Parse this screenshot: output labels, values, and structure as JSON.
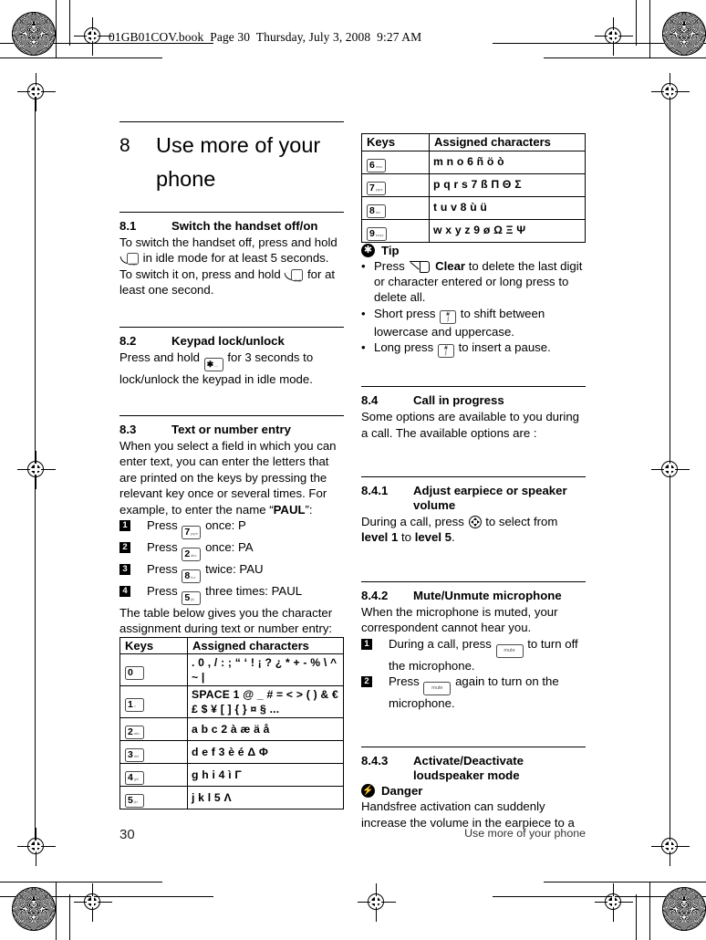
{
  "page_header": "01GB01COV.book  Page 30  Thursday, July 3, 2008  9:27 AM",
  "chapter": {
    "number": "8",
    "title_line1": "Use more of your",
    "title_line2": "phone"
  },
  "sections": {
    "s81": {
      "num": "8.1",
      "title": "Switch the handset off/on",
      "p1a": "To switch the handset off, press and hold",
      "p1b": "in idle mode for at least 5 seconds. To switch it on, press and hold",
      "p1c": "for at least one second."
    },
    "s82": {
      "num": "8.2",
      "title": "Keypad lock/unlock",
      "p1a": "Press and hold",
      "p1b": "for 3 seconds to lock/unlock the keypad in idle mode."
    },
    "s83": {
      "num": "8.3",
      "title": "Text or number entry",
      "p1": "When you select a field in which you can enter text, you can enter the letters that are printed on the keys by pressing the relevant key once or several times. For example, to enter the name “",
      "p1_bold": "PAUL",
      "p1_end": "”:",
      "steps": [
        {
          "n": "1",
          "pre": "Press",
          "key": "7",
          "post": "once: P"
        },
        {
          "n": "2",
          "pre": "Press",
          "key": "2",
          "post": "once: PA"
        },
        {
          "n": "3",
          "pre": "Press",
          "key": "8",
          "post": "twice: PAU"
        },
        {
          "n": "4",
          "pre": "Press",
          "key": "5",
          "post": "three times: PAUL"
        }
      ],
      "p2": "The table below gives you the character assignment during text or number entry:"
    },
    "s84": {
      "num": "8.4",
      "title": "Call in progress",
      "p1": "Some options are available to you during a call. The available options are :"
    },
    "s841": {
      "num": "8.4.1",
      "title_line1": "Adjust earpiece or speaker",
      "title_line2": "volume",
      "p1a": "During a call, press",
      "p1b": "to select from",
      "p1_b1": "level 1",
      "p1c": "to",
      "p1_b2": "level 5",
      "p1d": "."
    },
    "s842": {
      "num": "8.4.2",
      "title": "Mute/Unmute microphone",
      "p1": "When the microphone is muted, your correspondent cannot hear you.",
      "steps": [
        {
          "n": "1",
          "pre": "During a call, press",
          "key": "mute",
          "post": "to turn off the microphone."
        },
        {
          "n": "2",
          "pre": "Press",
          "key": "mute",
          "post": "again to turn on the microphone."
        }
      ]
    },
    "s843": {
      "num": "8.4.3",
      "title_line1": "Activate/Deactivate",
      "title_line2": "loudspeaker mode",
      "danger_label": "Danger",
      "p1": "Handsfree activation can suddenly increase the volume in the earpiece to a"
    }
  },
  "tip": {
    "label": "Tip",
    "items": [
      {
        "pre": "Press",
        "key": "clear",
        "bold": "Clear",
        "post": "to delete the last digit or character entered or long press to delete all."
      },
      {
        "pre": "Short press",
        "key": "hash",
        "post": "to shift between lowercase and uppercase."
      },
      {
        "pre": "Long press",
        "key": "hash",
        "post": "to insert a pause."
      }
    ]
  },
  "table_left": {
    "headers": [
      "Keys",
      "Assigned characters"
    ],
    "rows": [
      {
        "key": "0",
        "key_sub": "",
        "chars": ". 0 , / : ;  “ ‘ ! ¡ ? ¿ * + - % \\ ^ ~ |"
      },
      {
        "key": "1",
        "key_sub": "⌂",
        "chars": "SPACE 1 @ _ # = < > ( ) & € £ $ ¥ [ ] { } ¤ § ..."
      },
      {
        "key": "2",
        "key_sub": "abc",
        "chars": "a b c 2 à æ ä å"
      },
      {
        "key": "3",
        "key_sub": "def",
        "chars": "d e f 3 è é Δ Φ"
      },
      {
        "key": "4",
        "key_sub": "ghi",
        "chars": "g h i 4 ì Γ"
      },
      {
        "key": "5",
        "key_sub": "jkl",
        "chars": "j k l 5 Λ"
      }
    ]
  },
  "table_right": {
    "headers": [
      "Keys",
      "Assigned characters"
    ],
    "rows": [
      {
        "key": "6",
        "key_sub": "mno",
        "chars": "m n o 6 ñ ö ò"
      },
      {
        "key": "7",
        "key_sub": "pqrs",
        "chars": "p q r s 7 ß Π Θ Σ"
      },
      {
        "key": "8",
        "key_sub": "tuv",
        "chars": "t u v 8 ù ü"
      },
      {
        "key": "9",
        "key_sub": "wxyz",
        "chars": "w x y z 9 ø Ω Ξ Ψ"
      }
    ]
  },
  "footer": {
    "page_number": "30",
    "running_title": "Use more of your phone"
  }
}
